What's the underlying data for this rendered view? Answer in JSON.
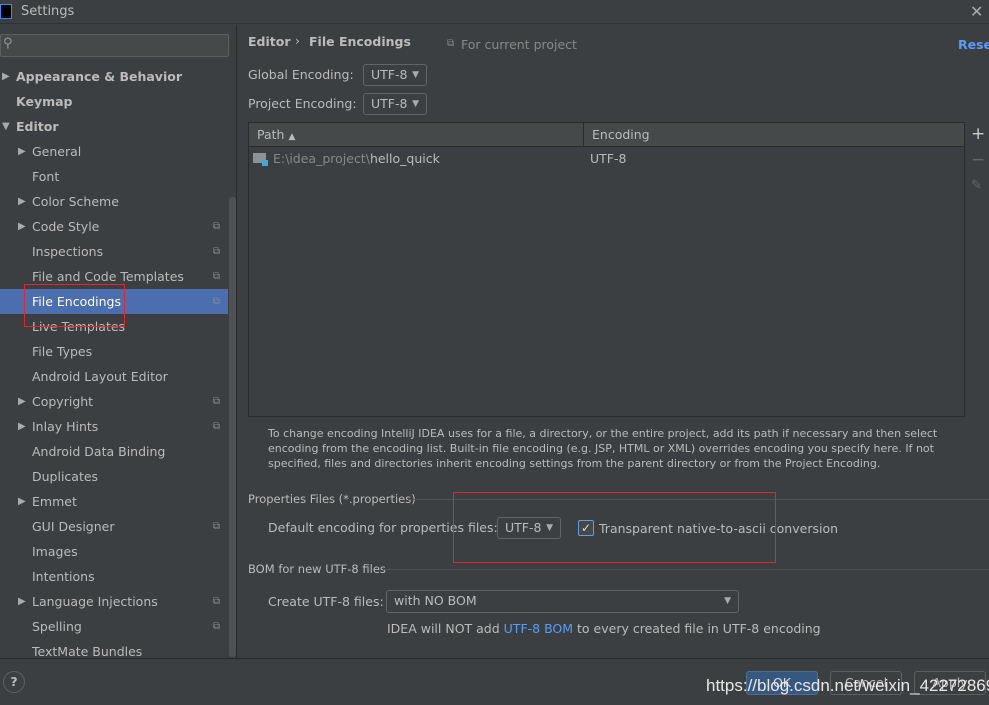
{
  "window": {
    "title": "Settings"
  },
  "sidebar": {
    "search_placeholder": "",
    "items": [
      {
        "label": "Appearance & Behavior",
        "level": 0,
        "arrow": "right",
        "bold": true
      },
      {
        "label": "Keymap",
        "level": 0,
        "bold": true
      },
      {
        "label": "Editor",
        "level": 0,
        "arrow": "down",
        "bold": true
      },
      {
        "label": "General",
        "level": 1,
        "arrow": "right"
      },
      {
        "label": "Font",
        "level": 1
      },
      {
        "label": "Color Scheme",
        "level": 1,
        "arrow": "right"
      },
      {
        "label": "Code Style",
        "level": 1,
        "arrow": "right",
        "copy": true
      },
      {
        "label": "Inspections",
        "level": 1,
        "copy": true
      },
      {
        "label": "File and Code Templates",
        "level": 1,
        "copy": true
      },
      {
        "label": "File Encodings",
        "level": 1,
        "copy": true,
        "selected": true
      },
      {
        "label": "Live Templates",
        "level": 1
      },
      {
        "label": "File Types",
        "level": 1
      },
      {
        "label": "Android Layout Editor",
        "level": 1
      },
      {
        "label": "Copyright",
        "level": 1,
        "arrow": "right",
        "copy": true
      },
      {
        "label": "Inlay Hints",
        "level": 1,
        "arrow": "right",
        "copy": true
      },
      {
        "label": "Android Data Binding",
        "level": 1
      },
      {
        "label": "Duplicates",
        "level": 1
      },
      {
        "label": "Emmet",
        "level": 1,
        "arrow": "right"
      },
      {
        "label": "GUI Designer",
        "level": 1,
        "copy": true
      },
      {
        "label": "Images",
        "level": 1
      },
      {
        "label": "Intentions",
        "level": 1
      },
      {
        "label": "Language Injections",
        "level": 1,
        "arrow": "right",
        "copy": true
      },
      {
        "label": "Spelling",
        "level": 1,
        "copy": true
      },
      {
        "label": "TextMate Bundles",
        "level": 1
      }
    ]
  },
  "header": {
    "breadcrumb_parent": "Editor",
    "breadcrumb_sep": "›",
    "breadcrumb_current": "File Encodings",
    "scope": "For current project",
    "reset": "Reset"
  },
  "global_encoding": {
    "label": "Global Encoding:",
    "value": "UTF-8"
  },
  "project_encoding": {
    "label": "Project Encoding:",
    "value": "UTF-8"
  },
  "table": {
    "columns": [
      "Path",
      "Encoding"
    ],
    "rows": [
      {
        "path_prefix": "E:\\idea_project\\",
        "path_name": "hello_quick",
        "encoding": "UTF-8"
      }
    ]
  },
  "info_text": "To change encoding IntelliJ IDEA uses for a file, a directory, or the entire project, add its path if necessary and then select encoding from the encoding list. Built-in file encoding (e.g. JSP, HTML or XML) overrides encoding you specify here. If not specified, files and directories inherit encoding settings from the parent directory or from the Project Encoding.",
  "properties": {
    "section": "Properties Files (*.properties)",
    "label": "Default encoding for properties files:",
    "value": "UTF-8",
    "checkbox_label": "Transparent native-to-ascii conversion",
    "checked": true
  },
  "bom": {
    "section": "BOM for new UTF-8 files",
    "label": "Create UTF-8 files:",
    "value": "with NO BOM",
    "note_before": "IDEA will NOT add ",
    "note_link": "UTF-8 BOM",
    "note_after": " to every created file in UTF-8 encoding"
  },
  "buttons": {
    "ok": "OK",
    "cancel": "Cancel",
    "apply": "Apply",
    "help": "?"
  },
  "watermark": "https://blog.csdn.net/weixin_42272869",
  "colors": {
    "accent": "#4b6eaf",
    "link": "#589df6",
    "highlight_box": "#e0282e"
  }
}
